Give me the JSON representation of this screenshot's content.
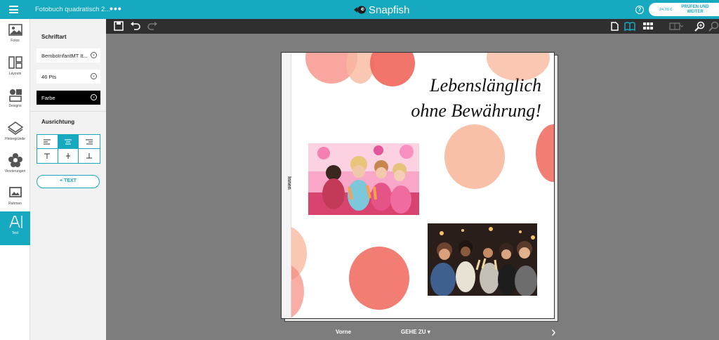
{
  "topbar": {
    "doc_title": "Fotobuch quadratisch 2...",
    "more": "•••",
    "brand": "Snapfish",
    "help": "?",
    "price": "24,99 €",
    "checkout_label": "PRÜFEN UND WEITER"
  },
  "rail": {
    "items": [
      {
        "label": "Fotos",
        "icon": "photos-icon"
      },
      {
        "label": "Layouts",
        "icon": "layouts-icon"
      },
      {
        "label": "Designs",
        "icon": "designs-icon"
      },
      {
        "label": "Hintergründe",
        "icon": "backgrounds-icon"
      },
      {
        "label": "Verzierungen",
        "icon": "embellishments-icon"
      },
      {
        "label": "Rahmen",
        "icon": "frames-icon"
      },
      {
        "label": "Text",
        "icon": "text-icon",
        "active": true
      }
    ]
  },
  "panel": {
    "font_section": "Schriftart",
    "font_name": "BemboInfantMT It...",
    "font_size": "46 Pts",
    "color_label": "Farbe",
    "align_section": "Ausrichtung",
    "add_text": "+ TEXT"
  },
  "page": {
    "spine_label": "Innen",
    "heading_line1": "Lebenslänglich",
    "heading_line2": "ohne Bewährung!"
  },
  "bottom": {
    "front": "Vorne",
    "goto": "GEHE ZU ▾",
    "next": "›"
  },
  "colors": {
    "accent": "#17a9c0",
    "dot_coral": "#f78a7e",
    "dot_peach": "#f8b99f",
    "dot_red": "#f0665a"
  }
}
